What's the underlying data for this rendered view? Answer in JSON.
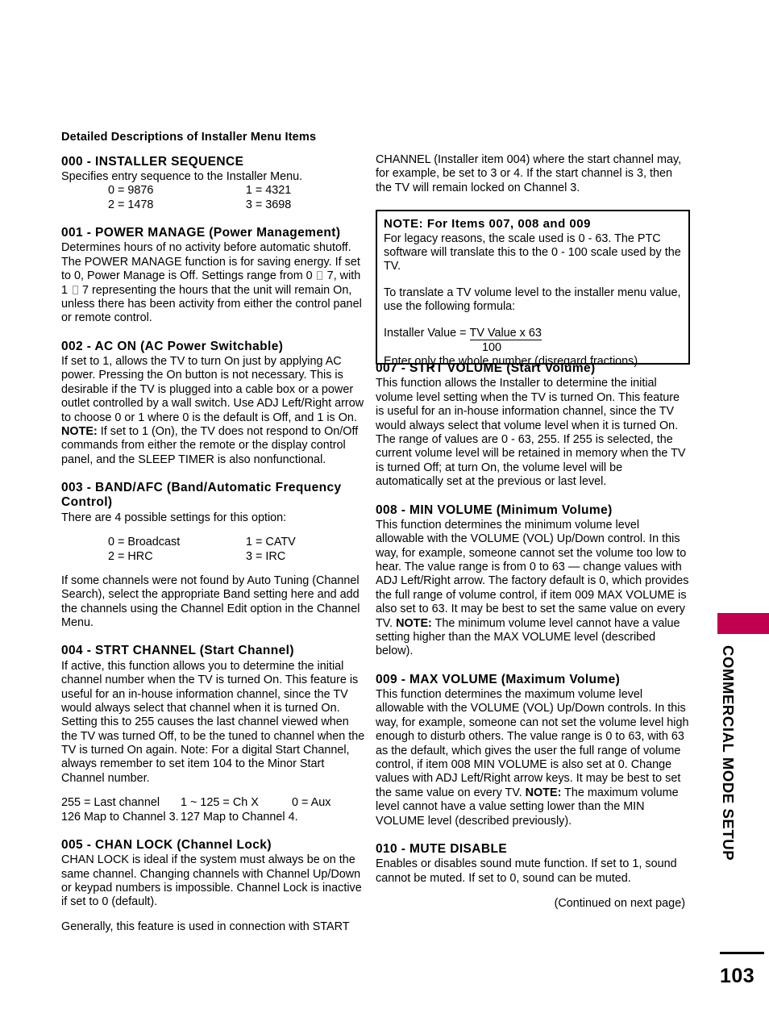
{
  "document": {
    "title": "Detailed Descriptions of Installer Menu Items",
    "page_number": "103",
    "side_tab_label": "COMMERCIAL MODE SETUP",
    "side_tab_color": "#c10050",
    "continued_note": "(Continued on next page)"
  },
  "left_column": {
    "sections": [
      {
        "heading": "000 - INSTALLER SEQUENCE",
        "body": "Specifies entry sequence to the Installer Menu.",
        "values": [
          {
            "left": "0 = 9876",
            "right": "1 = 4321"
          },
          {
            "left": "2 = 1478",
            "right": "3 = 3698"
          }
        ]
      },
      {
        "heading": "001 - POWER MANAGE (Power Management)",
        "body_part1": "Determines hours of no activity before automatic shutoff. The POWER MANAGE function is for saving energy. If set to 0, Power Manage is Off. Settings range from 0 ",
        "body_part2": " 7, with 1 ",
        "body_part3": " 7 representing the hours that the unit will remain On, unless there has been activity from either the control panel or remote control."
      },
      {
        "heading": "002 - AC ON (AC Power Switchable)",
        "body": "If set to 1, allows the TV to turn On just by applying AC power. Pressing the On button is not necessary. This is desirable if the TV is plugged into a cable box or a power outlet controlled by a wall switch. Use ADJ Left/Right arrow to choose 0 or 1 where 0 is the default is Off, and 1 is On.",
        "note_label": "NOTE:",
        "note_body": " If set to 1 (On), the TV does not respond to On/Off commands from either the remote or the display control panel, and the SLEEP TIMER is also nonfunctional."
      },
      {
        "heading": "003 - BAND/AFC (Band/Automatic Frequency Control)",
        "body": "There are 4 possible settings for this option:",
        "values": [
          {
            "left": "0 = Broadcast",
            "right": "1 = CATV"
          },
          {
            "left": "2 = HRC",
            "right": "3 = IRC"
          }
        ],
        "body_after": "If some channels were not found by Auto Tuning (Channel Search), select the appropriate Band setting here and add the channels using the Channel Edit option in the Channel Menu."
      },
      {
        "heading": "004 - STRT CHANNEL (Start Channel)",
        "body": "If active, this function allows you to determine the initial channel number when the TV is turned On. This feature is useful for an in-house information channel, since the TV would always select that channel when it is turned On. Setting this to 255 causes the last channel viewed when the TV was turned Off, to be the tuned to channel when the TV is turned On again.  Note: For a digital Start Channel, always remember to set item 104 to the Minor Start Channel number.",
        "values_row1": {
          "c1": "255 = Last channel",
          "c2": "1 ~ 125 = Ch X",
          "c3": "0 = Aux"
        },
        "values_row2": {
          "c1": "126 Map to Channel 3.",
          "c2": "127 Map to Channel 4."
        }
      },
      {
        "heading": "005 - CHAN LOCK (Channel Lock)",
        "body": "CHAN LOCK is ideal if the system must always be on the same channel. Changing channels with Channel Up/Down or keypad numbers is impossible. Channel Lock is inactive if set to 0 (default).",
        "body_after": "Generally, this feature is used in connection with START"
      }
    ]
  },
  "right_column": {
    "intro": "CHANNEL (Installer item 004) where the start channel may, for example, be set to 3 or 4. If the start channel is 3, then the TV will remain locked on Channel 3.",
    "note_box": {
      "heading": "NOTE: For Items 007, 008 and 009",
      "para1": "For legacy reasons, the scale used is 0 - 63. The PTC software will translate this to the 0 - 100 scale used by the TV.",
      "para2": "To translate a TV volume level to the installer menu value, use the following formula:",
      "formula_label": "Installer Value = ",
      "formula_numerator": "TV Value x 63",
      "formula_denominator": "100",
      "para3": "Enter only the whole number (disregard fractions)."
    },
    "sections": [
      {
        "heading": "007 - STRT VOLUME (Start Volume)",
        "body": "This function allows the Installer to determine the initial volume level setting when the TV is turned On. This feature is useful for an in-house information channel, since the TV would always select that volume level when it is turned On. The range of values are 0 - 63, 255. If 255 is selected, the current volume level will be retained in memory when the TV is turned Off; at turn On, the volume level will be automatically set at the previous or last level."
      },
      {
        "heading": "008 - MIN VOLUME (Minimum Volume)",
        "body": "This function determines the minimum volume level allowable with the VOLUME (VOL) Up/Down control. In this way, for example, someone cannot set the volume too low to hear. The value range is from 0 to 63 — change values with ADJ Left/Right arrow. The factory default is 0, which provides the full range of volume control, if item 009 MAX VOLUME is also set to 63. It may be best to set the same value on every TV.",
        "note_label": "NOTE:",
        "note_body": " The minimum volume level cannot have a value setting higher than the MAX VOLUME level (described below)."
      },
      {
        "heading": "009 - MAX VOLUME (Maximum Volume)",
        "body": "This function determines the maximum volume level allowable with the VOLUME (VOL) Up/Down controls. In this way, for example, someone can not set the volume level high enough to disturb others. The value range is 0 to 63, with 63 as the default, which gives the user the full range of volume control, if item 008 MIN VOLUME is also set at 0. Change values with ADJ Left/Right arrow keys. It may be best to set the same value on every TV.",
        "note_label": "NOTE:",
        "note_body": " The maximum volume level cannot have a value setting lower than the MIN VOLUME level (described previously)."
      },
      {
        "heading": "010 - MUTE DISABLE",
        "body": "Enables or disables sound mute function. If set to 1, sound cannot be muted. If set to 0, sound can be muted."
      }
    ]
  }
}
